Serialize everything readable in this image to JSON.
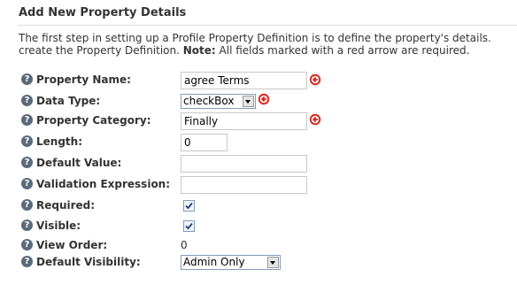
{
  "section_title": "Add New Property Details",
  "intro": {
    "line1": "The first step in setting up a Profile Property Definition is to define the property's details. ",
    "line2_before": "create the Property Definition. ",
    "note_label": "Note:",
    "line2_after": " All fields marked with a red arrow are required."
  },
  "form": {
    "property_name": {
      "label": "Property Name:",
      "value": "agree Terms",
      "required": true
    },
    "data_type": {
      "label": "Data Type:",
      "selected": "checkBox",
      "required": true
    },
    "property_category": {
      "label": "Property Category:",
      "value": "Finally",
      "required": true
    },
    "length": {
      "label": "Length:",
      "value": "0"
    },
    "default_value": {
      "label": "Default Value:",
      "value": ""
    },
    "validation_expression": {
      "label": "Validation Expression:",
      "value": ""
    },
    "required_flag": {
      "label": "Required:",
      "checked": true
    },
    "visible_flag": {
      "label": "Visible:",
      "checked": true
    },
    "view_order": {
      "label": "View Order:",
      "value": "0"
    },
    "default_visibility": {
      "label": "Default Visibility:",
      "selected": "Admin Only"
    }
  },
  "icons": {
    "help": "help-icon",
    "required": "required-arrow-icon",
    "dropdown": "chevron-down-icon",
    "check": "checkmark-icon"
  },
  "colors": {
    "required_arrow": "#d9261c",
    "help_icon": "#5a6a78",
    "checkbox_border": "#7f9db9"
  },
  "help_glyph": "?"
}
